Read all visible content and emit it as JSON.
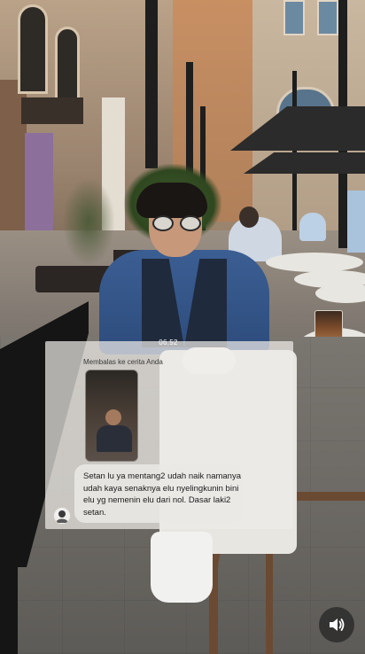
{
  "story": {
    "timestamp": "06.52",
    "reply_label": "Membalas ke cerita Anda",
    "message": "Setan lu ya mentang2 udah naik namanya udah kaya senaknya elu nyelingkunin bini elu yg nemenin elu dari nol. Dasar laki2 setan."
  },
  "icons": {
    "sound": "speaker-icon",
    "avatar": "user-avatar"
  },
  "colors": {
    "overlay": "#eeece8",
    "sound_button": "#282828"
  }
}
